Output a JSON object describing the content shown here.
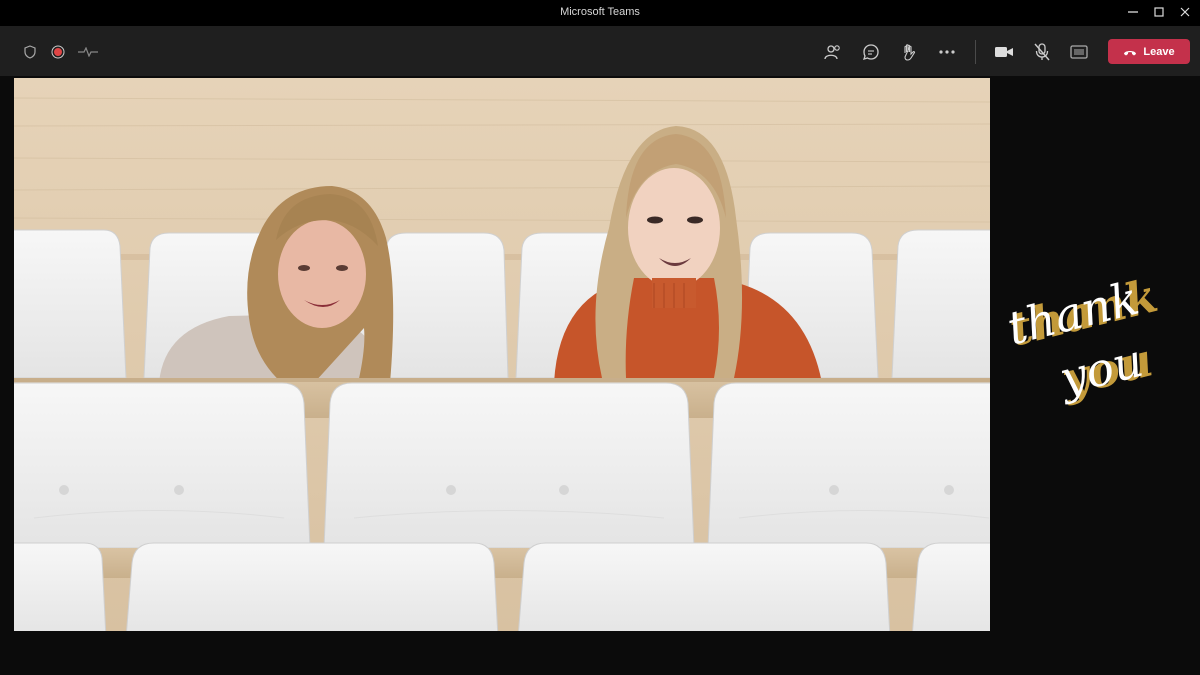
{
  "window": {
    "title": "Microsoft Teams"
  },
  "toolbar": {
    "leave_label": "Leave"
  },
  "stage": {
    "view": "Together mode"
  },
  "overlay": {
    "thank": "thank",
    "you": "you"
  },
  "colors": {
    "leave": "#c4314b",
    "record": "#e04545",
    "gold": "#c39a3a"
  }
}
